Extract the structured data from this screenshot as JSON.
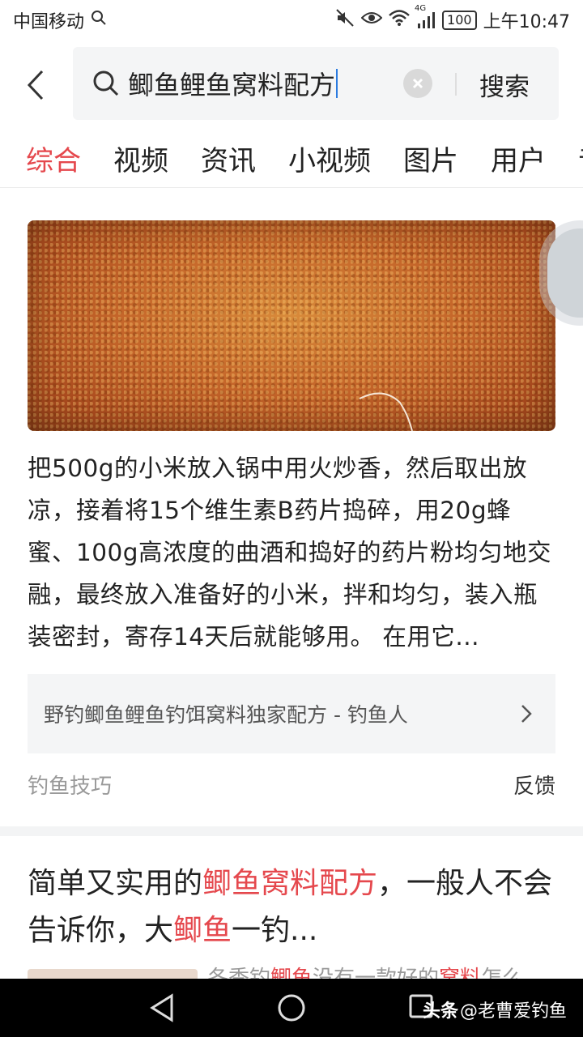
{
  "status": {
    "carrier": "中国移动",
    "signal_label": "4G",
    "battery": "100",
    "time": "上午10:47"
  },
  "search": {
    "query": "鲫鱼鲤鱼窝料配方",
    "button_label": "搜索"
  },
  "tabs": [
    {
      "label": "综合",
      "active": true
    },
    {
      "label": "视频"
    },
    {
      "label": "资讯"
    },
    {
      "label": "小视频"
    },
    {
      "label": "图片"
    },
    {
      "label": "用户"
    },
    {
      "label": "音"
    }
  ],
  "result1": {
    "text": "把500g的小米放入锅中用火炒香，然后取出放凉，接着将15个维生素B药片捣碎，用20g蜂蜜、100g高浓度的曲酒和捣好的药片粉均匀地交融，最终放入准备好的小米，拌和均匀，装入瓶装密封，寄存14天后就能够用。 在用它...",
    "source_title": "野钓鲫鱼鲤鱼钓饵窝料独家配方 - 钓鱼人",
    "tag": "钓鱼技巧",
    "feedback": "反馈"
  },
  "result2": {
    "headline_parts": [
      {
        "text": "简单又实用的",
        "hl": false
      },
      {
        "text": "鲫鱼窝料配方",
        "hl": true
      },
      {
        "text": "，一般人不会告诉你，大",
        "hl": false
      },
      {
        "text": "鲫鱼",
        "hl": true
      },
      {
        "text": "一钓...",
        "hl": false
      }
    ],
    "snippet_parts": [
      {
        "text": "冬季钓",
        "hl": false
      },
      {
        "text": "鲫鱼",
        "hl": true
      },
      {
        "text": "没有一款好的",
        "hl": false
      },
      {
        "text": "窝料",
        "hl": true
      },
      {
        "text": "怎么",
        "hl": false
      }
    ]
  },
  "watermark": {
    "brand": "头条",
    "handle": "@老曹爱钓鱼"
  },
  "colors": {
    "accent": "#e5484d",
    "caret": "#2b7be0"
  }
}
